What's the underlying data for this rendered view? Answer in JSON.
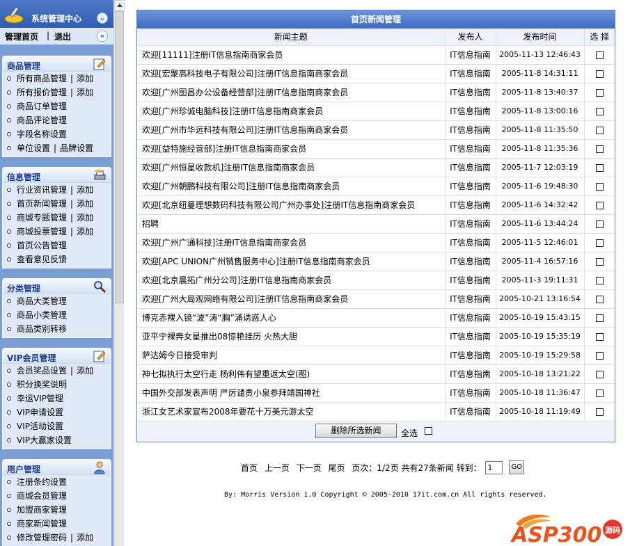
{
  "sidebar": {
    "title": "系统管理中心",
    "home": "管理首页",
    "sep": "|",
    "logout": "退出",
    "groups": [
      {
        "title": "商品管理",
        "icon": "edit-icon",
        "items": [
          [
            "所有商品管理",
            "添加"
          ],
          [
            "所有报价管理",
            "添加"
          ],
          [
            "商品订单管理"
          ],
          [
            "商品评论管理"
          ],
          [
            "字段名称设置"
          ],
          [
            "单位设置",
            "品牌设置"
          ]
        ]
      },
      {
        "title": "信息管理",
        "icon": "printer-icon",
        "items": [
          [
            "行业资讯管理",
            "添加"
          ],
          [
            "首页新闻管理",
            "添加"
          ],
          [
            "商城专题管理",
            "添加"
          ],
          [
            "商城投票管理",
            "添加"
          ],
          [
            "首页公告管理"
          ],
          [
            "查看意见反馈"
          ]
        ]
      },
      {
        "title": "分类管理",
        "icon": "magnifier-icon",
        "items": [
          [
            "商品大类管理"
          ],
          [
            "商品小类管理"
          ],
          [
            "商品类别转移"
          ]
        ]
      },
      {
        "title": "VIP会员管理",
        "icon": "edit-icon",
        "items": [
          [
            "会员奖品设置",
            "添加"
          ],
          [
            "积分换奖说明"
          ],
          [
            "幸运VIP管理"
          ],
          [
            "VIP申请设置"
          ],
          [
            "VIP活动设置"
          ],
          [
            "VIP大赢家设置"
          ]
        ]
      },
      {
        "title": "用户管理",
        "icon": "user-icon",
        "items": [
          [
            "注册条约设置"
          ],
          [
            "商城会员管理"
          ],
          [
            "加盟商家管理"
          ],
          [
            "商家新闻管理"
          ],
          [
            "修改管理密码",
            "添加"
          ]
        ]
      }
    ]
  },
  "panel": {
    "title": "首页新闻管理",
    "headers": {
      "subject": "新闻主题",
      "publisher": "发布人",
      "time": "发布时间",
      "select": "选 择"
    },
    "rows": [
      {
        "subject": "欢迎[11111]注册IT信息指南商家会员",
        "publisher": "IT信息指南",
        "time": "2005-11-13 12:46:43"
      },
      {
        "subject": "欢迎[宏聚高科技电子有限公司]注册IT信息指南商家会员",
        "publisher": "IT信息指南",
        "time": "2005-11-8 14:31:11"
      },
      {
        "subject": "欢迎[广州图昌办公设备经营部]注册IT信息指南商家会员",
        "publisher": "IT信息指南",
        "time": "2005-11-8 13:40:37"
      },
      {
        "subject": "欢迎[广州珍诚电脑科技]注册IT信息指南商家会员",
        "publisher": "IT信息指南",
        "time": "2005-11-8 13:00:16"
      },
      {
        "subject": "欢迎[广州市华远科技有限公司]注册IT信息指南商家会员",
        "publisher": "IT信息指南",
        "time": "2005-11-8 11:35:50"
      },
      {
        "subject": "欢迎[益特施经营部]注册IT信息指南商家会员",
        "publisher": "IT信息指南",
        "time": "2005-11-8 11:35:36"
      },
      {
        "subject": "欢迎[广州恒星收款机]注册IT信息指南商家会员",
        "publisher": "IT信息指南",
        "time": "2005-11-7 12:03:19"
      },
      {
        "subject": "欢迎[广州朝鹏科技有限公司]注册IT信息指南商家会员",
        "publisher": "IT信息指南",
        "time": "2005-11-6 19:48:30"
      },
      {
        "subject": "欢迎[北京纽曼理想数码科技有限公司广州办事处]注册IT信息指南商家会员",
        "publisher": "IT信息指南",
        "time": "2005-11-6 14:32:42"
      },
      {
        "subject": "招聘",
        "publisher": "IT信息指南",
        "time": "2005-11-6 13:44:24"
      },
      {
        "subject": "欢迎[广州广通科技]注册IT信息指南商家会员",
        "publisher": "IT信息指南",
        "time": "2005-11-5 12:46:01"
      },
      {
        "subject": "欢迎[APC UNION广州销售服务中心]注册IT信息指南商家会员",
        "publisher": "IT信息指南",
        "time": "2005-11-4 16:57:16"
      },
      {
        "subject": "欢迎[北京晨拓广州分公司]注册IT信息指南商家会员",
        "publisher": "IT信息指南",
        "time": "2005-11-3 19:11:31"
      },
      {
        "subject": "欢迎[广州大局观网络有限公司]注册IT信息指南商家会员",
        "publisher": "IT信息指南",
        "time": "2005-10-21 13:16:54"
      },
      {
        "subject": "博克赤裸入镜“波”涛“胸”涌诱惑人心",
        "publisher": "IT信息指南",
        "time": "2005-10-19 15:43:15"
      },
      {
        "subject": "亚平宁裸奔女星推出08惊艳挂历 火热大胆",
        "publisher": "IT信息指南",
        "time": "2005-10-19 15:35:19"
      },
      {
        "subject": "萨达姆今日接受审判",
        "publisher": "IT信息指南",
        "time": "2005-10-19 15:29:58"
      },
      {
        "subject": "神七拟执行太空行走 杨利伟有望重返太空(图)",
        "publisher": "IT信息指南",
        "time": "2005-10-18 13:21:22"
      },
      {
        "subject": "中国外交部发表声明 严厉谴责小泉参拜靖国神社",
        "publisher": "IT信息指南",
        "time": "2005-10-18 11:36:47"
      },
      {
        "subject": "浙江女艺术家宣布2008年要花十万美元游太空",
        "publisher": "IT信息指南",
        "time": "2005-10-18 11:19:49"
      }
    ],
    "delete_label": "删除所选新闻",
    "select_all_label": "全选"
  },
  "pager": {
    "first": "首页",
    "prev": "上一页",
    "next": "下一页",
    "last": "尾页",
    "info": "页次：1/2页 共有27条新闻 转到：",
    "go_value": "1",
    "go_label": "GO"
  },
  "copyright": "By: Morris Version 1.0 Copyright © 2005-2010 17it.com.cn All rights reserved.",
  "watermark": {
    "brand": "ASP300",
    "sub": "源码"
  },
  "colors": {
    "header_blue": "#3d69bd",
    "sidebar_bg": "#7a9dd6",
    "panel_border": "#5b83c9"
  }
}
